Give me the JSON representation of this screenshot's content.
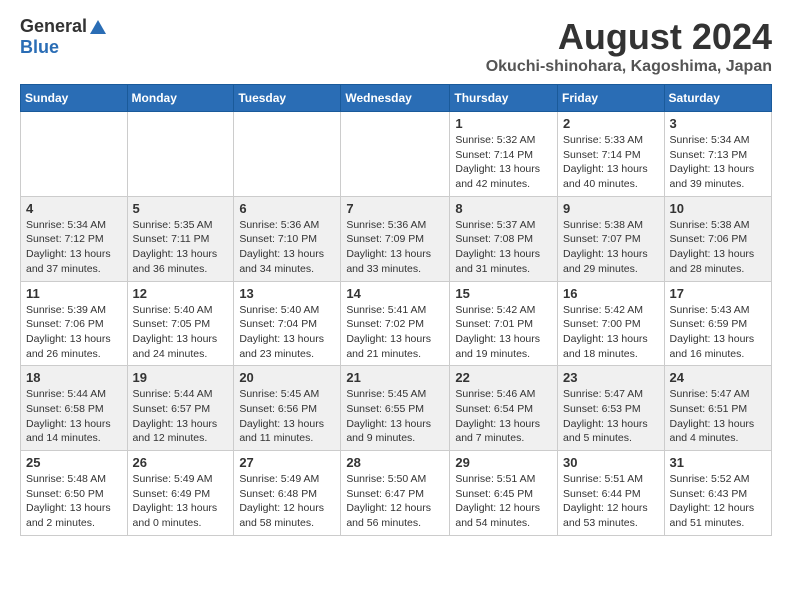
{
  "logo": {
    "general": "General",
    "blue": "Blue"
  },
  "title": "August 2024",
  "location": "Okuchi-shinohara, Kagoshima, Japan",
  "headers": [
    "Sunday",
    "Monday",
    "Tuesday",
    "Wednesday",
    "Thursday",
    "Friday",
    "Saturday"
  ],
  "weeks": [
    [
      {
        "day": "",
        "info": ""
      },
      {
        "day": "",
        "info": ""
      },
      {
        "day": "",
        "info": ""
      },
      {
        "day": "",
        "info": ""
      },
      {
        "day": "1",
        "info": "Sunrise: 5:32 AM\nSunset: 7:14 PM\nDaylight: 13 hours\nand 42 minutes."
      },
      {
        "day": "2",
        "info": "Sunrise: 5:33 AM\nSunset: 7:14 PM\nDaylight: 13 hours\nand 40 minutes."
      },
      {
        "day": "3",
        "info": "Sunrise: 5:34 AM\nSunset: 7:13 PM\nDaylight: 13 hours\nand 39 minutes."
      }
    ],
    [
      {
        "day": "4",
        "info": "Sunrise: 5:34 AM\nSunset: 7:12 PM\nDaylight: 13 hours\nand 37 minutes."
      },
      {
        "day": "5",
        "info": "Sunrise: 5:35 AM\nSunset: 7:11 PM\nDaylight: 13 hours\nand 36 minutes."
      },
      {
        "day": "6",
        "info": "Sunrise: 5:36 AM\nSunset: 7:10 PM\nDaylight: 13 hours\nand 34 minutes."
      },
      {
        "day": "7",
        "info": "Sunrise: 5:36 AM\nSunset: 7:09 PM\nDaylight: 13 hours\nand 33 minutes."
      },
      {
        "day": "8",
        "info": "Sunrise: 5:37 AM\nSunset: 7:08 PM\nDaylight: 13 hours\nand 31 minutes."
      },
      {
        "day": "9",
        "info": "Sunrise: 5:38 AM\nSunset: 7:07 PM\nDaylight: 13 hours\nand 29 minutes."
      },
      {
        "day": "10",
        "info": "Sunrise: 5:38 AM\nSunset: 7:06 PM\nDaylight: 13 hours\nand 28 minutes."
      }
    ],
    [
      {
        "day": "11",
        "info": "Sunrise: 5:39 AM\nSunset: 7:06 PM\nDaylight: 13 hours\nand 26 minutes."
      },
      {
        "day": "12",
        "info": "Sunrise: 5:40 AM\nSunset: 7:05 PM\nDaylight: 13 hours\nand 24 minutes."
      },
      {
        "day": "13",
        "info": "Sunrise: 5:40 AM\nSunset: 7:04 PM\nDaylight: 13 hours\nand 23 minutes."
      },
      {
        "day": "14",
        "info": "Sunrise: 5:41 AM\nSunset: 7:02 PM\nDaylight: 13 hours\nand 21 minutes."
      },
      {
        "day": "15",
        "info": "Sunrise: 5:42 AM\nSunset: 7:01 PM\nDaylight: 13 hours\nand 19 minutes."
      },
      {
        "day": "16",
        "info": "Sunrise: 5:42 AM\nSunset: 7:00 PM\nDaylight: 13 hours\nand 18 minutes."
      },
      {
        "day": "17",
        "info": "Sunrise: 5:43 AM\nSunset: 6:59 PM\nDaylight: 13 hours\nand 16 minutes."
      }
    ],
    [
      {
        "day": "18",
        "info": "Sunrise: 5:44 AM\nSunset: 6:58 PM\nDaylight: 13 hours\nand 14 minutes."
      },
      {
        "day": "19",
        "info": "Sunrise: 5:44 AM\nSunset: 6:57 PM\nDaylight: 13 hours\nand 12 minutes."
      },
      {
        "day": "20",
        "info": "Sunrise: 5:45 AM\nSunset: 6:56 PM\nDaylight: 13 hours\nand 11 minutes."
      },
      {
        "day": "21",
        "info": "Sunrise: 5:45 AM\nSunset: 6:55 PM\nDaylight: 13 hours\nand 9 minutes."
      },
      {
        "day": "22",
        "info": "Sunrise: 5:46 AM\nSunset: 6:54 PM\nDaylight: 13 hours\nand 7 minutes."
      },
      {
        "day": "23",
        "info": "Sunrise: 5:47 AM\nSunset: 6:53 PM\nDaylight: 13 hours\nand 5 minutes."
      },
      {
        "day": "24",
        "info": "Sunrise: 5:47 AM\nSunset: 6:51 PM\nDaylight: 13 hours\nand 4 minutes."
      }
    ],
    [
      {
        "day": "25",
        "info": "Sunrise: 5:48 AM\nSunset: 6:50 PM\nDaylight: 13 hours\nand 2 minutes."
      },
      {
        "day": "26",
        "info": "Sunrise: 5:49 AM\nSunset: 6:49 PM\nDaylight: 13 hours\nand 0 minutes."
      },
      {
        "day": "27",
        "info": "Sunrise: 5:49 AM\nSunset: 6:48 PM\nDaylight: 12 hours\nand 58 minutes."
      },
      {
        "day": "28",
        "info": "Sunrise: 5:50 AM\nSunset: 6:47 PM\nDaylight: 12 hours\nand 56 minutes."
      },
      {
        "day": "29",
        "info": "Sunrise: 5:51 AM\nSunset: 6:45 PM\nDaylight: 12 hours\nand 54 minutes."
      },
      {
        "day": "30",
        "info": "Sunrise: 5:51 AM\nSunset: 6:44 PM\nDaylight: 12 hours\nand 53 minutes."
      },
      {
        "day": "31",
        "info": "Sunrise: 5:52 AM\nSunset: 6:43 PM\nDaylight: 12 hours\nand 51 minutes."
      }
    ]
  ]
}
